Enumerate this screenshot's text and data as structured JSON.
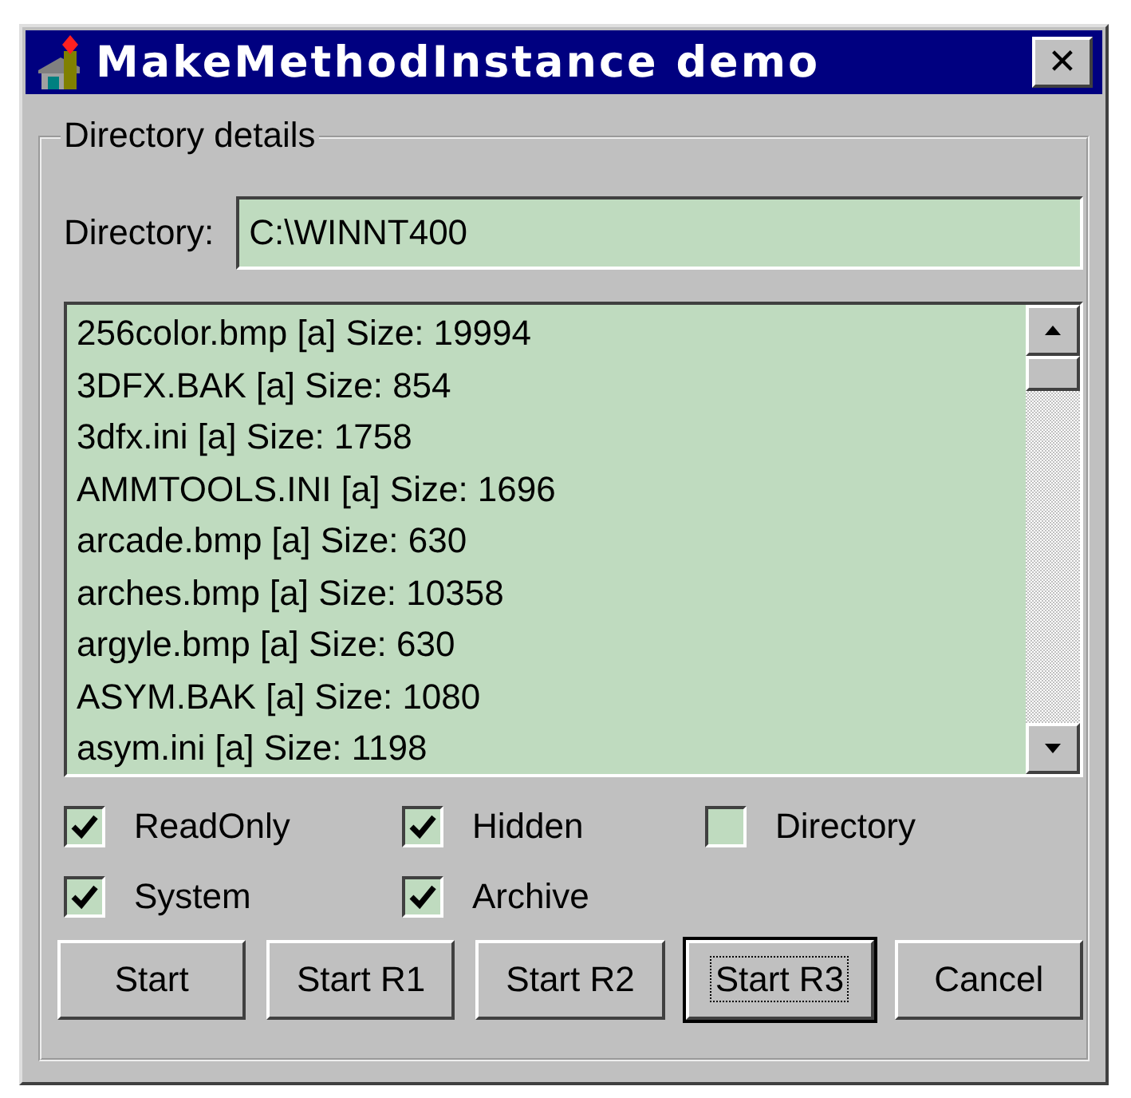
{
  "window": {
    "title": "MakeMethodInstance demo",
    "close": "✕"
  },
  "group": {
    "caption": "Directory details"
  },
  "directory": {
    "label": "Directory:",
    "value": "C:\\WINNT400"
  },
  "files": [
    "256color.bmp [a] Size: 19994",
    "3DFX.BAK [a] Size: 854",
    "3dfx.ini [a] Size: 1758",
    "AMMTOOLS.INI [a] Size: 1696",
    "arcade.bmp [a] Size: 630",
    "arches.bmp [a] Size: 10358",
    "argyle.bmp [a] Size: 630",
    "ASYM.BAK [a] Size: 1080",
    "asym.ini [a] Size: 1198"
  ],
  "checkboxes": [
    {
      "label": "ReadOnly",
      "checked": true
    },
    {
      "label": "Hidden",
      "checked": true
    },
    {
      "label": "Directory",
      "checked": false
    },
    {
      "label": "System",
      "checked": true
    },
    {
      "label": "Archive",
      "checked": true
    }
  ],
  "buttons": [
    {
      "label": "Start",
      "focused": false
    },
    {
      "label": "Start R1",
      "focused": false
    },
    {
      "label": "Start R2",
      "focused": false
    },
    {
      "label": "Start R3",
      "focused": true
    },
    {
      "label": "Cancel",
      "focused": false
    }
  ]
}
